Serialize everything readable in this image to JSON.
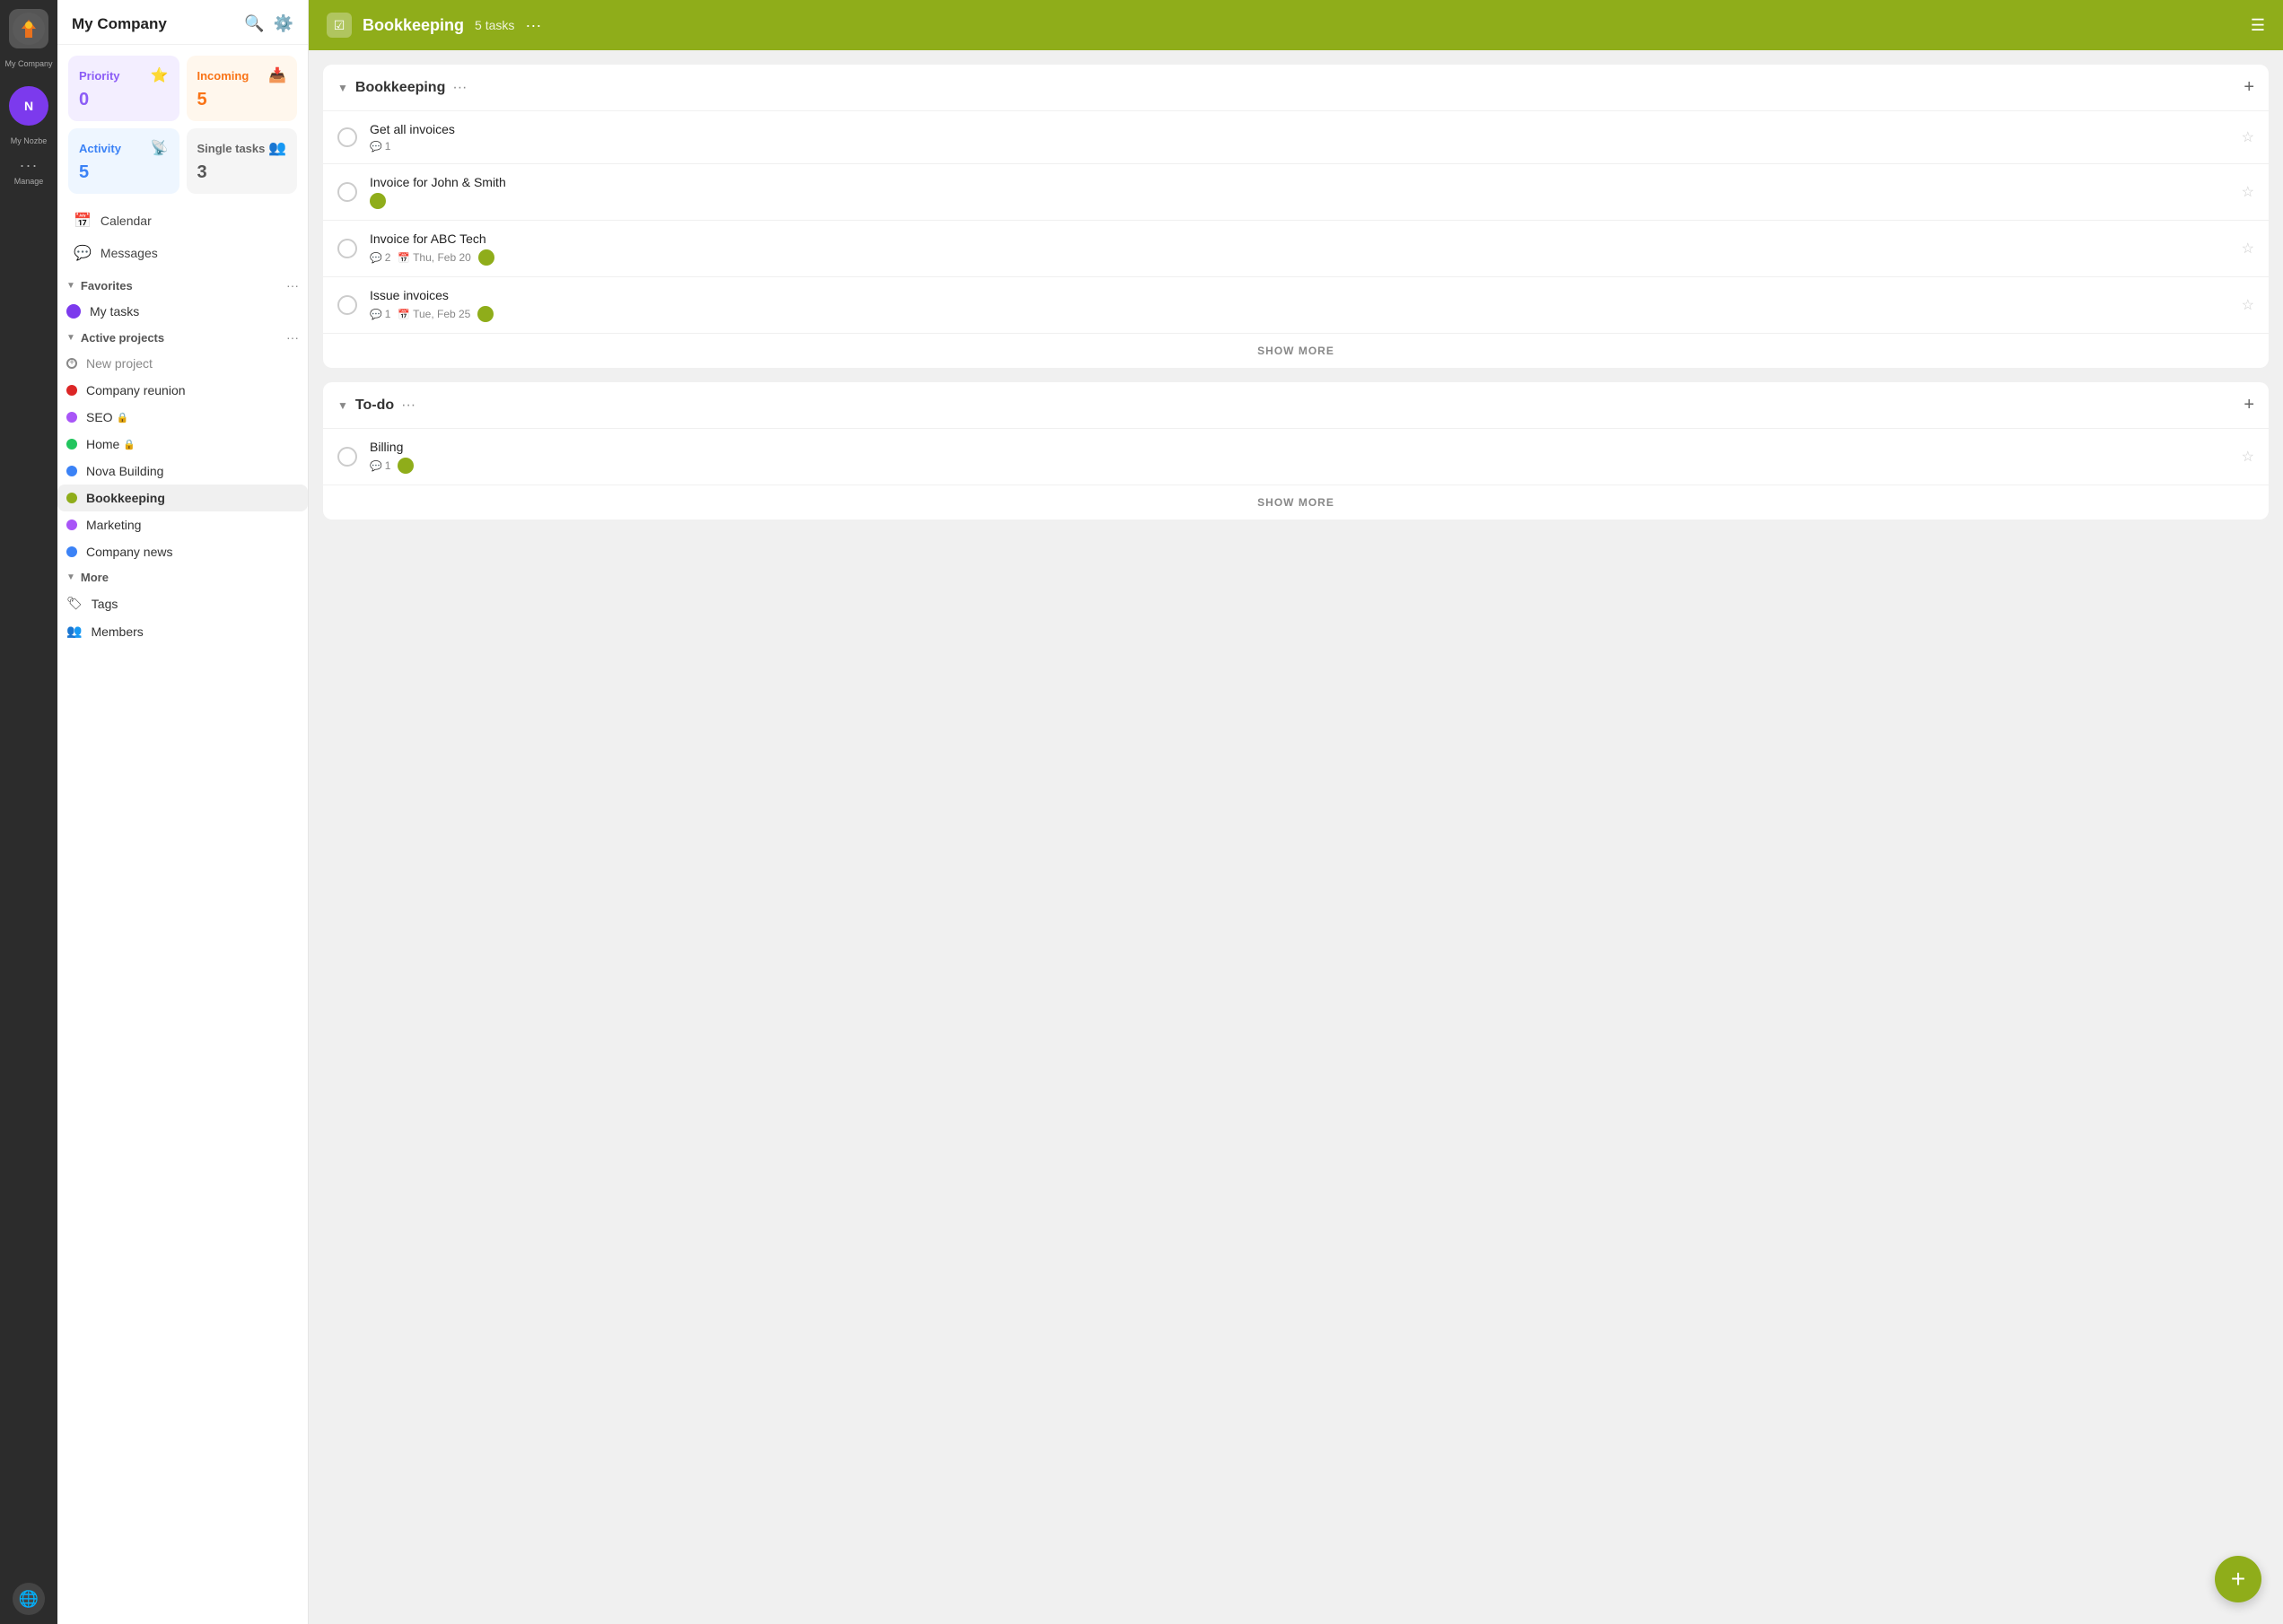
{
  "iconBar": {
    "companyName": "My Company",
    "userName": "My Nozbe",
    "manageLabel": "Manage",
    "globeLabel": "Globe"
  },
  "sidebar": {
    "title": "My Company",
    "searchLabel": "Search",
    "settingsLabel": "Settings",
    "cards": {
      "priority": {
        "label": "Priority",
        "count": "0"
      },
      "incoming": {
        "label": "Incoming",
        "count": "5"
      },
      "activity": {
        "label": "Activity",
        "count": "5"
      },
      "single": {
        "label": "Single tasks",
        "count": "3"
      }
    },
    "navItems": [
      {
        "label": "Calendar",
        "icon": "📅"
      },
      {
        "label": "Messages",
        "icon": "💬"
      }
    ],
    "favoritesLabel": "Favorites",
    "myTasksLabel": "My tasks",
    "activeProjectsLabel": "Active projects",
    "newProjectLabel": "New project",
    "projects": [
      {
        "name": "Company reunion",
        "color": "#dc2626",
        "locked": false,
        "active": false
      },
      {
        "name": "SEO",
        "color": "#a855f7",
        "locked": true,
        "active": false
      },
      {
        "name": "Home",
        "color": "#22c55e",
        "locked": true,
        "active": false
      },
      {
        "name": "Nova Building",
        "color": "#3b82f6",
        "locked": false,
        "active": false
      },
      {
        "name": "Bookkeeping",
        "color": "#8fad1a",
        "locked": false,
        "active": true
      },
      {
        "name": "Marketing",
        "color": "#a855f7",
        "locked": false,
        "active": false
      },
      {
        "name": "Company news",
        "color": "#3b82f6",
        "locked": false,
        "active": false
      }
    ],
    "moreSectionLabel": "More",
    "moreItems": [
      {
        "label": "Tags",
        "icon": "🏷"
      },
      {
        "label": "Members",
        "icon": "👥"
      }
    ]
  },
  "main": {
    "projectName": "Bookkeeping",
    "taskCount": "5 tasks",
    "moreLabel": "···",
    "sections": [
      {
        "title": "Bookkeeping",
        "tasks": [
          {
            "name": "Get all invoices",
            "commentCount": "1",
            "date": null,
            "hasAvatar": false
          },
          {
            "name": "Invoice for John & Smith",
            "commentCount": null,
            "date": null,
            "hasAvatar": true,
            "avatarColor": "av-green"
          },
          {
            "name": "Invoice for ABC Tech",
            "commentCount": "2",
            "date": "Thu, Feb 20",
            "hasAvatar": true,
            "avatarColor": "av-green"
          },
          {
            "name": "Issue invoices",
            "commentCount": "1",
            "date": "Tue, Feb 25",
            "hasAvatar": true,
            "avatarColor": "av-green"
          }
        ],
        "showMoreLabel": "SHOW MORE"
      },
      {
        "title": "To-do",
        "tasks": [
          {
            "name": "Billing",
            "commentCount": "1",
            "date": null,
            "hasAvatar": true,
            "avatarColor": "av-green"
          }
        ],
        "showMoreLabel": "SHOW MORE"
      }
    ],
    "fabLabel": "+"
  }
}
